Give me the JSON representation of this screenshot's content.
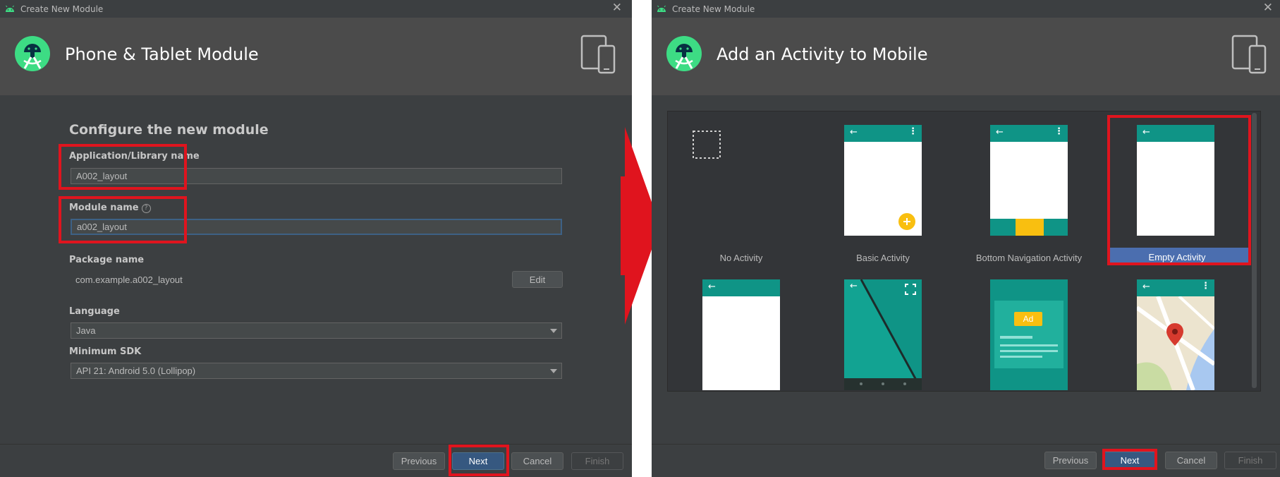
{
  "left_dialog": {
    "window_title": "Create New Module",
    "banner_title": "Phone & Tablet Module",
    "heading": "Configure the new module",
    "fields": {
      "app_name_label": "Application/Library name",
      "app_name_value": "A002_layout",
      "module_name_label": "Module name",
      "module_name_value": "a002_layout",
      "package_label": "Package name",
      "package_value": "com.example.a002_layout",
      "edit_label": "Edit",
      "language_label": "Language",
      "language_value": "Java",
      "sdk_label": "Minimum SDK",
      "sdk_value": "API 21: Android 5.0 (Lollipop)"
    },
    "buttons": {
      "previous": "Previous",
      "next": "Next",
      "cancel": "Cancel",
      "finish": "Finish"
    }
  },
  "right_dialog": {
    "window_title": "Create New Module",
    "banner_title": "Add an Activity to Mobile",
    "activities": [
      {
        "name": "No Activity"
      },
      {
        "name": "Basic Activity"
      },
      {
        "name": "Bottom Navigation Activity"
      },
      {
        "name": "Empty Activity",
        "selected": true
      },
      {
        "name": ""
      },
      {
        "name": ""
      },
      {
        "name": ""
      },
      {
        "name": ""
      }
    ],
    "ad_label": "Ad",
    "buttons": {
      "previous": "Previous",
      "next": "Next",
      "cancel": "Cancel",
      "finish": "Finish"
    }
  },
  "colors": {
    "dialog_bg": "#3c3f41",
    "banner_bg": "#4b4b4b",
    "android_green": "#3ddc84",
    "teal": "#0f9486",
    "primary_button": "#365880",
    "selection": "#4b6eaf",
    "highlight_red": "#e0141e",
    "fab_yellow": "#f9bf10"
  },
  "icons": {
    "window": "android-icon",
    "banner": "android-studio-logo",
    "device": "phone-tablet-icon",
    "close": "close-icon",
    "connector": "red-arrow"
  }
}
